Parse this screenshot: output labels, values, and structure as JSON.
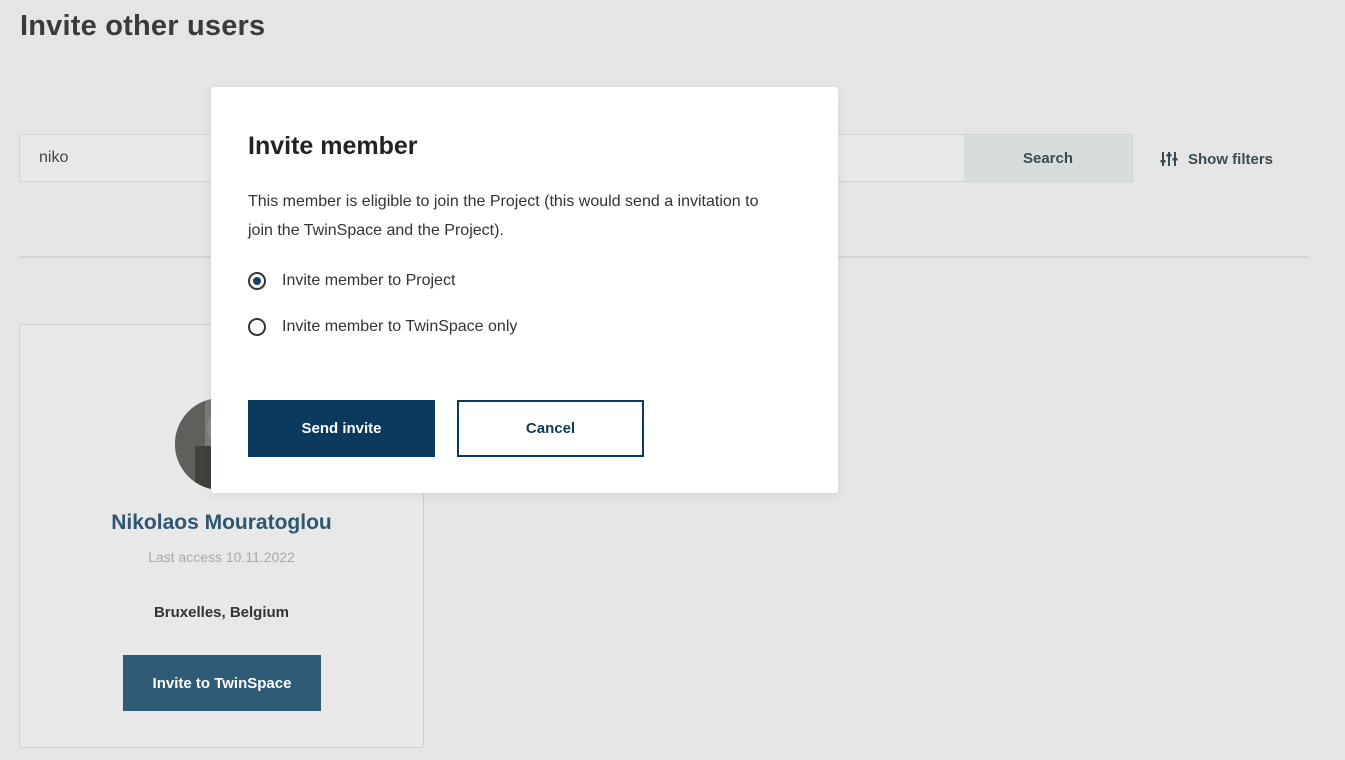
{
  "page": {
    "title": "Invite other users"
  },
  "search": {
    "value": "niko",
    "button_label": "Search",
    "filters_label": "Show filters",
    "filters_icon": "sliders-icon"
  },
  "user_card": {
    "name": "Nikolaos Mouratoglou",
    "last_access": "Last access 10.11.2022",
    "location": "Bruxelles, Belgium",
    "button_label": "Invite to TwinSpace"
  },
  "modal": {
    "title": "Invite member",
    "description": "This member is eligible to join the Project (this would send a invitation to join the TwinSpace and the Project).",
    "options": [
      {
        "label": "Invite member to Project",
        "selected": true
      },
      {
        "label": "Invite member to TwinSpace only",
        "selected": false
      }
    ],
    "send_label": "Send invite",
    "cancel_label": "Cancel"
  },
  "colors": {
    "primary": "#0c3a5f",
    "card_button": "#2e5a75",
    "user_name": "#2f5670",
    "background": "#e5e5e5"
  }
}
